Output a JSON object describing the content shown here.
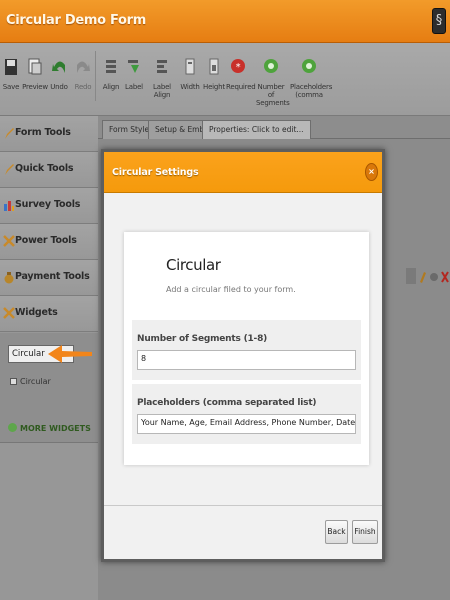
{
  "app": {
    "title": "Circular Demo Form"
  },
  "toolbar": {
    "items": [
      {
        "label": "Save",
        "icon": "save-icon"
      },
      {
        "label": "Preview",
        "icon": "preview-icon"
      },
      {
        "label": "Undo",
        "icon": "undo-icon"
      },
      {
        "label": "Redo",
        "icon": "redo-icon"
      },
      {
        "label": "Align",
        "icon": "align-icon"
      },
      {
        "label": "Label",
        "icon": "label-icon"
      },
      {
        "label": "Label Align",
        "icon": "label-align-icon"
      },
      {
        "label": "Width",
        "icon": "width-icon"
      },
      {
        "label": "Height",
        "icon": "height-icon"
      },
      {
        "label": "Required",
        "icon": "required-icon"
      },
      {
        "label": "Number of Segments",
        "icon": "green-dot-icon"
      },
      {
        "label": "Placeholders (comma",
        "icon": "green-dot-icon"
      }
    ]
  },
  "sidebar": {
    "items": [
      {
        "label": "Form Tools"
      },
      {
        "label": "Quick Tools"
      },
      {
        "label": "Survey Tools"
      },
      {
        "label": "Power Tools"
      },
      {
        "label": "Payment Tools"
      },
      {
        "label": "Widgets"
      }
    ],
    "widget_search": "Circular",
    "widget_result": "Circular",
    "more_widgets": "MORE WIDGETS"
  },
  "tabs": [
    {
      "label": "Form Style"
    },
    {
      "label": "Setup & Embed"
    },
    {
      "label": "Properties: Click to edit..."
    }
  ],
  "modal": {
    "title": "Circular Settings",
    "close_glyph": "×",
    "card_title": "Circular",
    "card_subtitle": "Add a circular filed to your form.",
    "fields": [
      {
        "label": "Number of Segments (1-8)",
        "value": "8"
      },
      {
        "label": "Placeholders (comma separated list)",
        "value": "Your Name, Age, Email Address, Phone Number, Date of Birth, Full Address, Notes"
      }
    ],
    "back_label": "Back",
    "finish_label": "Finish"
  },
  "colors": {
    "accent": "#f59a0c",
    "title_bar": "#e67d12",
    "arrow": "#f2851a"
  }
}
